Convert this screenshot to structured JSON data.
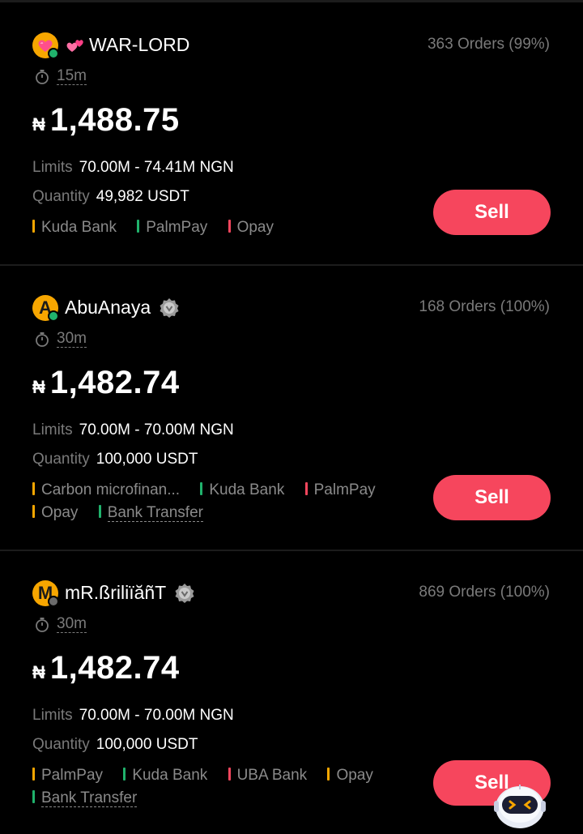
{
  "offers": [
    {
      "name": "💞WAR-LORD",
      "name_text": "WAR-LORD",
      "orders": "363 Orders (99%)",
      "time": "15m",
      "currency_symbol": "₦",
      "price": "1,488.75",
      "limits_label": "Limits",
      "limits": "70.00M - 74.41M NGN",
      "quantity_label": "Quantity",
      "quantity": "49,982 USDT",
      "payments": [
        {
          "label": "Kuda Bank",
          "color": "#f7a600"
        },
        {
          "label": "PalmPay",
          "color": "#20b26c"
        },
        {
          "label": "Opay",
          "color": "#f6465d"
        }
      ],
      "action": "Sell"
    },
    {
      "avatar_letter": "A",
      "name": "AbuAnaya",
      "orders": "168 Orders (100%)",
      "time": "30m",
      "currency_symbol": "₦",
      "price": "1,482.74",
      "limits_label": "Limits",
      "limits": "70.00M - 70.00M NGN",
      "quantity_label": "Quantity",
      "quantity": "100,000 USDT",
      "payments": [
        {
          "label": "Carbon microfinan...",
          "color": "#f7a600"
        },
        {
          "label": "Kuda Bank",
          "color": "#20b26c"
        },
        {
          "label": "PalmPay",
          "color": "#f6465d"
        },
        {
          "label": "Opay",
          "color": "#f7a600"
        },
        {
          "label": "Bank Transfer",
          "color": "#20b26c"
        }
      ],
      "action": "Sell"
    },
    {
      "avatar_letter": "M",
      "name": "mR.ßriliïăñT",
      "orders": "869 Orders (100%)",
      "time": "30m",
      "currency_symbol": "₦",
      "price": "1,482.74",
      "limits_label": "Limits",
      "limits": "70.00M - 70.00M NGN",
      "quantity_label": "Quantity",
      "quantity": "100,000 USDT",
      "payments": [
        {
          "label": "PalmPay",
          "color": "#f7a600"
        },
        {
          "label": "Kuda Bank",
          "color": "#20b26c"
        },
        {
          "label": "UBA Bank",
          "color": "#f6465d"
        },
        {
          "label": "Opay",
          "color": "#f7a600"
        },
        {
          "label": "Bank Transfer",
          "color": "#20b26c"
        }
      ],
      "action": "Sell"
    }
  ],
  "colors": {
    "background": "#000000",
    "sell_button": "#f6465d",
    "muted_text": "#7a7a7a",
    "avatar": "#f7a600",
    "online": "#20b26c"
  },
  "icons": [
    "heart-avatar-icon",
    "hearts-emoji-icon",
    "verified-badge-icon",
    "stopwatch-icon",
    "assistant-bot-icon"
  ]
}
